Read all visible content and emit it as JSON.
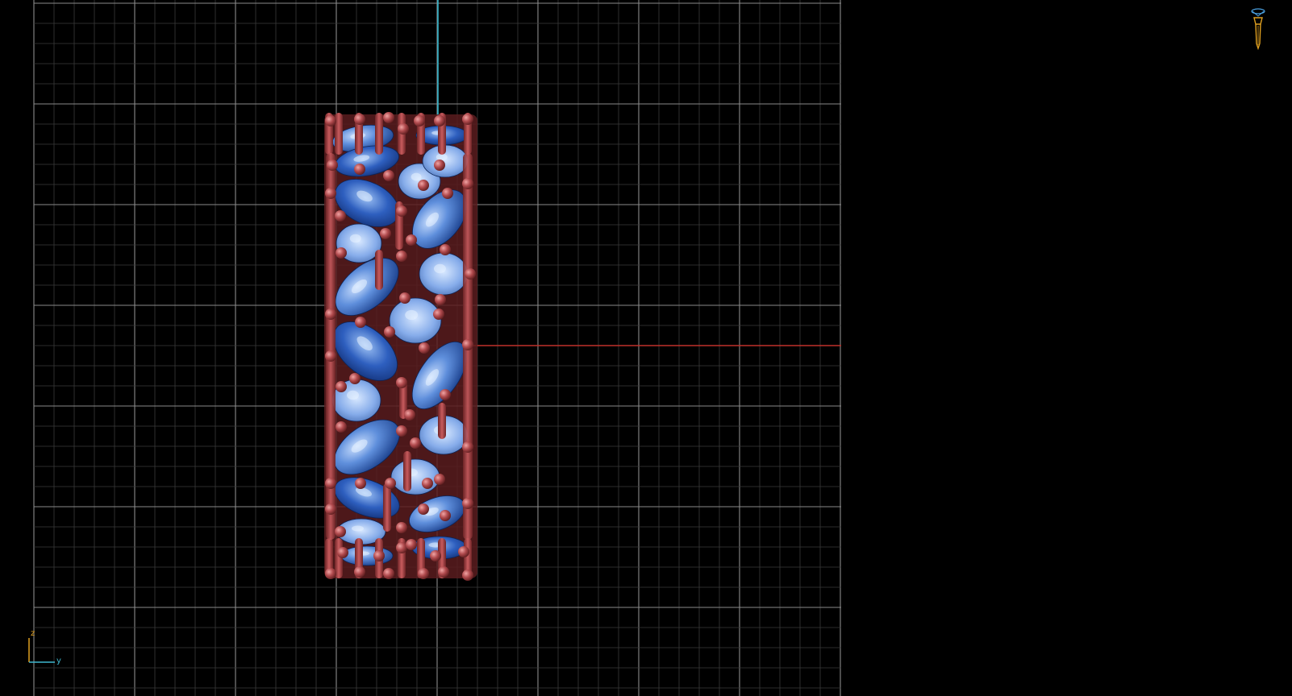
{
  "viewport": {
    "background": "#000000",
    "grid_color": "#5a5a5a",
    "grid_minor_color": "#3a3a3a",
    "axis_x_color": "#c0302a",
    "axis_z_color": "#2fb3c8",
    "model": {
      "metal_color": "#a8474a",
      "gem_colors": [
        "#1f4fa8",
        "#4a7ad0",
        "#8fb4ea",
        "#2d5fbf"
      ]
    }
  },
  "axis_gizmo": {
    "z_label": "z",
    "y_label": "y",
    "z_color": "#e0a020",
    "y_color": "#3fb8d0"
  },
  "toolbar_widget": {
    "icon": "render-brush-icon",
    "color": "#e0a020",
    "accent": "#4aa0e0"
  }
}
